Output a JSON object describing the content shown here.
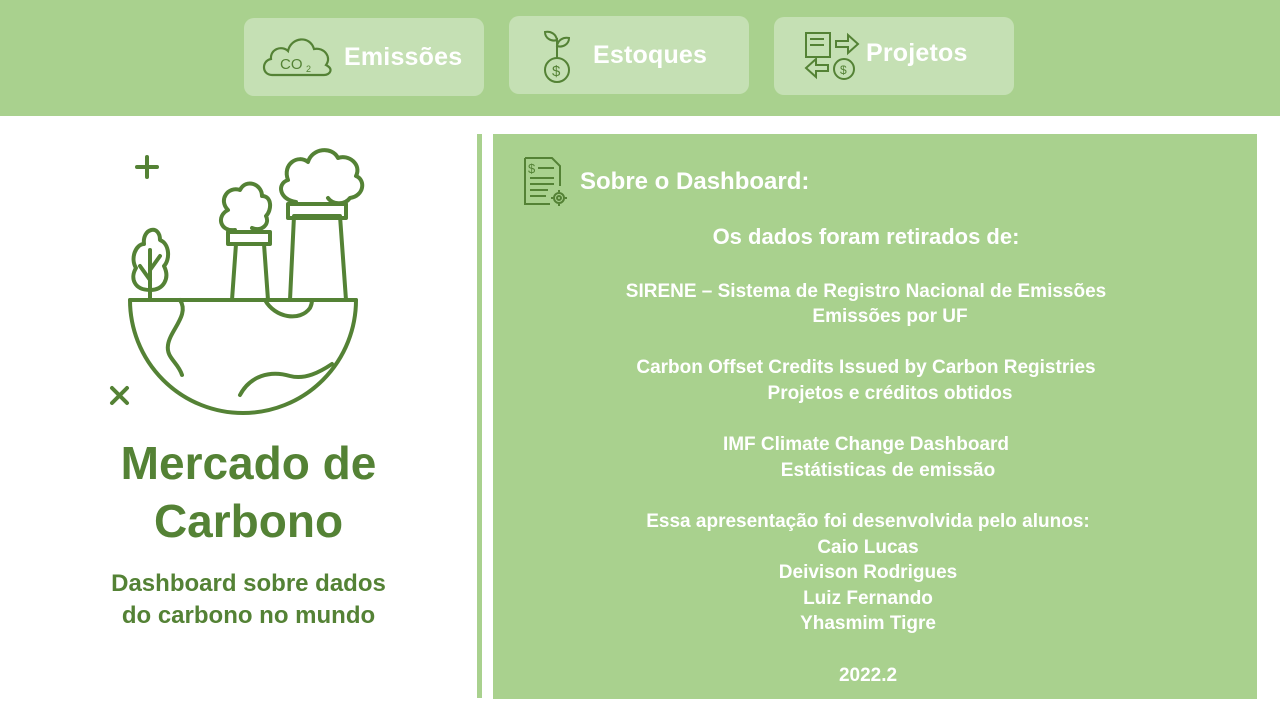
{
  "nav": {
    "emissoes": {
      "label": "Emissões",
      "icon": "co2-cloud-icon"
    },
    "estoques": {
      "label": "Estoques",
      "icon": "plant-coin-icon"
    },
    "projetos": {
      "label": "Projetos",
      "icon": "exchange-icon"
    }
  },
  "main": {
    "title_line1": "Mercado de",
    "title_line2": "Carbono",
    "subtitle_line1": "Dashboard sobre dados",
    "subtitle_line2": "do carbono no mundo",
    "illustration": "factory-earth-icon"
  },
  "info": {
    "heading": "Sobre o Dashboard:",
    "icon": "report-settings-icon",
    "sources_intro": "Os dados foram retirados de:",
    "source1_name": "SIRENE – Sistema de Registro Nacional de Emissões",
    "source1_desc": "Emissões por UF",
    "source2_name": "Carbon Offset Credits Issued by Carbon Registries",
    "source2_desc": "Projetos e créditos obtidos",
    "source3_name": "IMF Climate Change Dashboard",
    "source3_desc": "Estátisticas de emissão",
    "authors_intro": "Essa apresentação foi desenvolvida pelo alunos:",
    "authors": [
      "Caio Lucas",
      "Deivison Rodrigues",
      "Luiz Fernando",
      "Yhasmim Tigre"
    ],
    "period": "2022.2"
  },
  "colors": {
    "bar_green": "#a9d18e",
    "button_green": "#c5e0b4",
    "dark_green": "#548235",
    "text_white": "#ffffff"
  }
}
